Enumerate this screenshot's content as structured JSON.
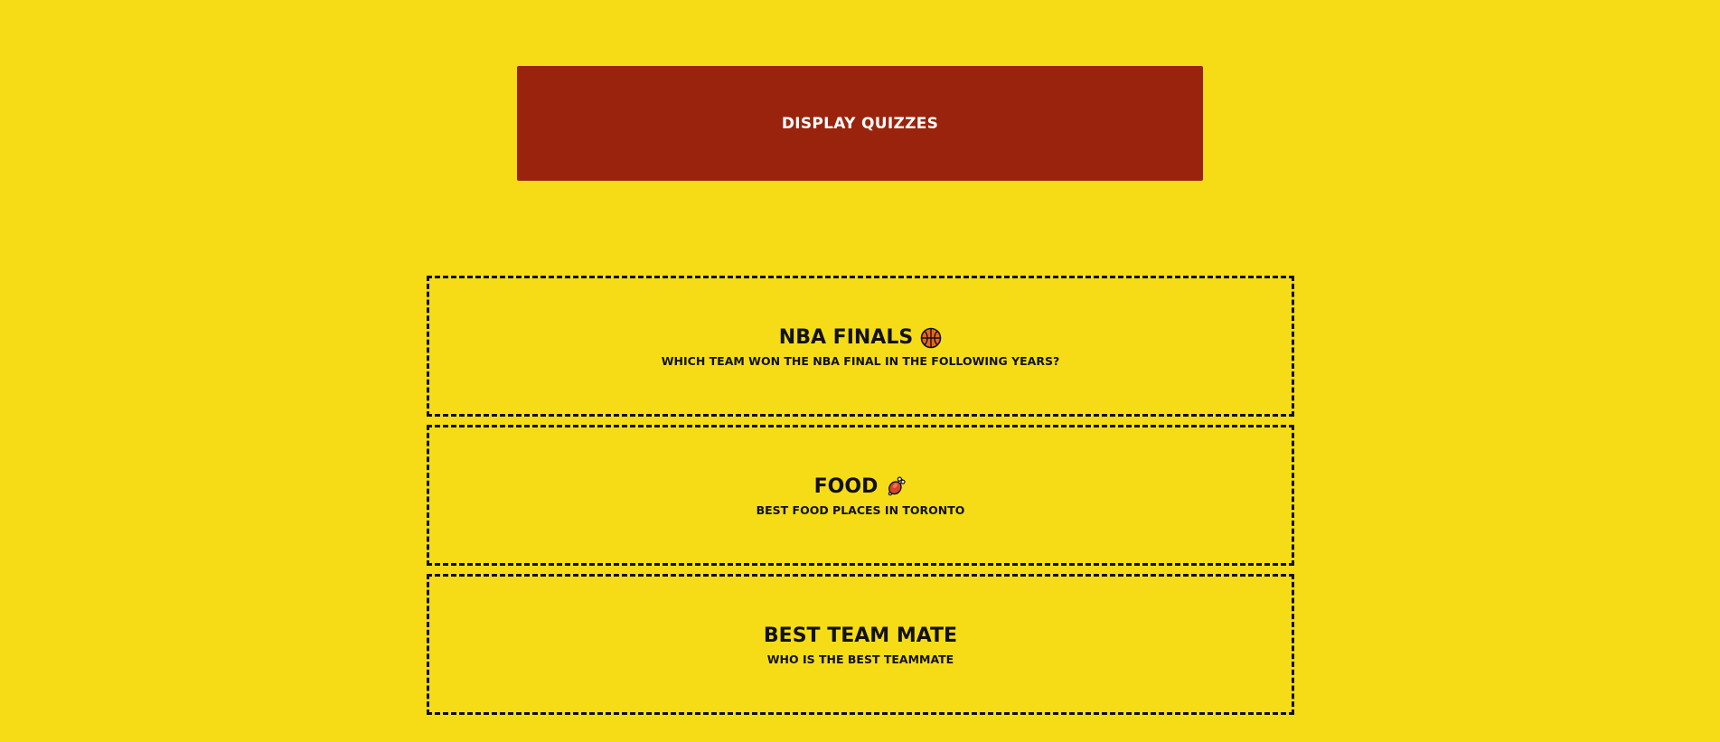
{
  "header": {
    "display_button_label": "Display Quizzes"
  },
  "quizzes": [
    {
      "title": "NBA Finals",
      "icon": "basketball-icon",
      "description": "Which team won the NBA Final in the following years?"
    },
    {
      "title": "Food",
      "icon": "meat-on-bone-icon",
      "description": "Best food places in Toronto"
    },
    {
      "title": "Best Team Mate",
      "icon": "",
      "description": "Who is the best teammate"
    }
  ],
  "colors": {
    "background": "#f5dc17",
    "button": "#9a230d",
    "text": "#111111"
  }
}
